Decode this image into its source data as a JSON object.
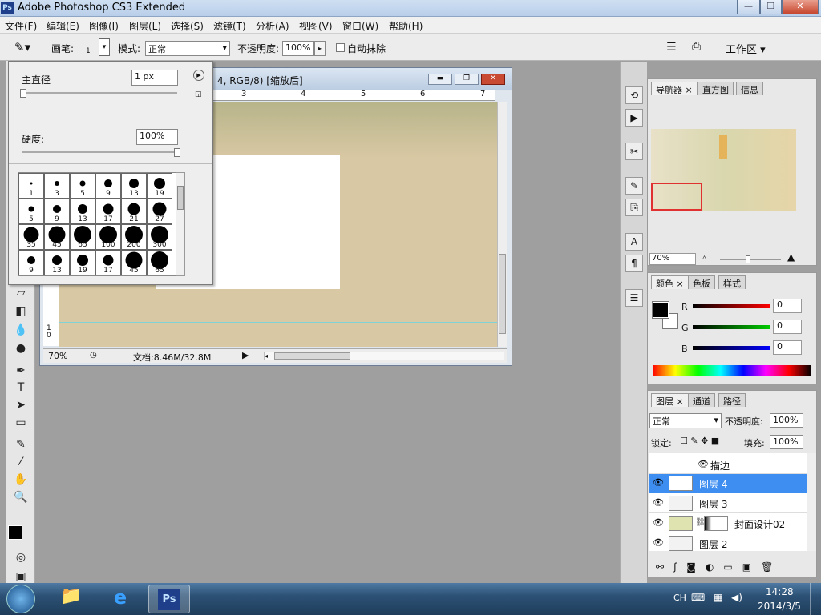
{
  "window": {
    "title": "Adobe Photoshop CS3 Extended",
    "logo": "Ps",
    "min": "—",
    "restore": "❐",
    "close": "✕"
  },
  "menu": [
    "文件(F)",
    "编辑(E)",
    "图像(I)",
    "图层(L)",
    "选择(S)",
    "滤镜(T)",
    "分析(A)",
    "视图(V)",
    "窗口(W)",
    "帮助(H)"
  ],
  "options": {
    "brush_label": "画笔:",
    "brush_size": "1",
    "mode_label": "模式:",
    "mode_value": "正常",
    "opacity_label": "不透明度:",
    "opacity_value": "100%",
    "auto_erase_label": "自动抹除",
    "workspace_label": "工作区 ▾"
  },
  "brush_panel": {
    "master_diameter_label": "主直径",
    "master_diameter_value": "1 px",
    "hardness_label": "硬度:",
    "hardness_value": "100%",
    "presets": [
      "1",
      "3",
      "5",
      "9",
      "13",
      "19",
      "5",
      "9",
      "13",
      "17",
      "21",
      "27",
      "35",
      "45",
      "65",
      "100",
      "200",
      "300",
      "9",
      "13",
      "19",
      "17",
      "45",
      "65"
    ]
  },
  "document": {
    "title": "4, RGB/8) [缩放后]",
    "zoom": "70%",
    "doc_info": "文档:8.46M/32.8M",
    "ruler_marks": [
      "3",
      "4",
      "5",
      "6",
      "7"
    ],
    "vruler_marks": [
      "1",
      "0"
    ]
  },
  "navigator": {
    "tabs": [
      "导航器",
      "直方图",
      "信息"
    ],
    "zoom": "70%"
  },
  "color": {
    "tabs": [
      "颜色",
      "色板",
      "样式"
    ],
    "r_label": "R",
    "g_label": "G",
    "b_label": "B",
    "r": "0",
    "g": "0",
    "b": "0"
  },
  "layers": {
    "tabs": [
      "图层",
      "通道",
      "路径"
    ],
    "blend": "正常",
    "opacity_label": "不透明度:",
    "opacity": "100%",
    "lock_label": "锁定:",
    "fill_label": "填充:",
    "fill": "100%",
    "effect_label": "描边",
    "items": [
      "图层 4",
      "图层 3",
      "封面设计02",
      "图层 2"
    ]
  },
  "taskbar": {
    "lang": "CH",
    "time": "14:28",
    "date": "2014/3/5"
  },
  "colors": {
    "selected_layer": "#3d8ef0",
    "canvas_sand": "#d8c8a3"
  }
}
